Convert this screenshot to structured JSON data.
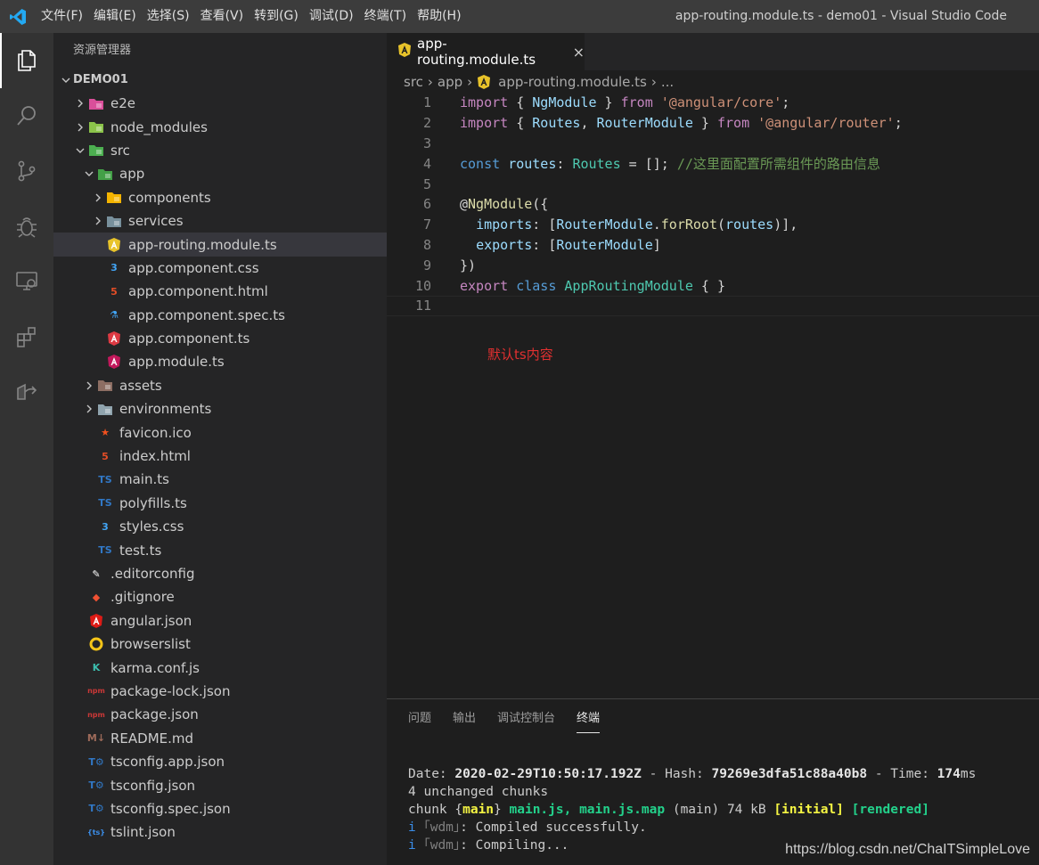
{
  "titlebar": {
    "menu": [
      "文件(F)",
      "编辑(E)",
      "选择(S)",
      "查看(V)",
      "转到(G)",
      "调试(D)",
      "终端(T)",
      "帮助(H)"
    ],
    "window_title": "app-routing.module.ts - demo01 - Visual Studio Code"
  },
  "activitybar": {
    "icons": [
      "explorer-icon",
      "search-icon",
      "source-control-icon",
      "debug-icon",
      "remote-explorer-icon",
      "extensions-icon",
      "live-share-icon"
    ]
  },
  "sidebar": {
    "title": "资源管理器",
    "section": "DEMO01",
    "items": [
      {
        "label": "e2e",
        "depth": 1,
        "chevron": "right",
        "icon": "folder-e2e-icon"
      },
      {
        "label": "node_modules",
        "depth": 1,
        "chevron": "right",
        "icon": "folder-node-icon"
      },
      {
        "label": "src",
        "depth": 1,
        "chevron": "down",
        "icon": "folder-src-icon"
      },
      {
        "label": "app",
        "depth": 2,
        "chevron": "down",
        "icon": "folder-app-icon"
      },
      {
        "label": "components",
        "depth": 3,
        "chevron": "right",
        "icon": "folder-components-icon"
      },
      {
        "label": "services",
        "depth": 3,
        "chevron": "right",
        "icon": "folder-services-icon"
      },
      {
        "label": "app-routing.module.ts",
        "depth": 3,
        "chevron": "",
        "icon": "angular-routing-icon",
        "selected": true
      },
      {
        "label": "app.component.css",
        "depth": 3,
        "chevron": "",
        "icon": "css-icon"
      },
      {
        "label": "app.component.html",
        "depth": 3,
        "chevron": "",
        "icon": "html-icon"
      },
      {
        "label": "app.component.spec.ts",
        "depth": 3,
        "chevron": "",
        "icon": "test-icon"
      },
      {
        "label": "app.component.ts",
        "depth": 3,
        "chevron": "",
        "icon": "angular-component-icon"
      },
      {
        "label": "app.module.ts",
        "depth": 3,
        "chevron": "",
        "icon": "angular-module-icon"
      },
      {
        "label": "assets",
        "depth": 2,
        "chevron": "right",
        "icon": "folder-assets-icon"
      },
      {
        "label": "environments",
        "depth": 2,
        "chevron": "right",
        "icon": "folder-icon"
      },
      {
        "label": "favicon.ico",
        "depth": 2,
        "chevron": "",
        "icon": "favicon-icon"
      },
      {
        "label": "index.html",
        "depth": 2,
        "chevron": "",
        "icon": "html-icon"
      },
      {
        "label": "main.ts",
        "depth": 2,
        "chevron": "",
        "icon": "typescript-icon"
      },
      {
        "label": "polyfills.ts",
        "depth": 2,
        "chevron": "",
        "icon": "typescript-icon"
      },
      {
        "label": "styles.css",
        "depth": 2,
        "chevron": "",
        "icon": "css-icon"
      },
      {
        "label": "test.ts",
        "depth": 2,
        "chevron": "",
        "icon": "typescript-icon"
      },
      {
        "label": ".editorconfig",
        "depth": 1,
        "chevron": "",
        "icon": "editorconfig-icon"
      },
      {
        "label": ".gitignore",
        "depth": 1,
        "chevron": "",
        "icon": "git-icon"
      },
      {
        "label": "angular.json",
        "depth": 1,
        "chevron": "",
        "icon": "angular-icon"
      },
      {
        "label": "browserslist",
        "depth": 1,
        "chevron": "",
        "icon": "browserslist-icon"
      },
      {
        "label": "karma.conf.js",
        "depth": 1,
        "chevron": "",
        "icon": "karma-icon"
      },
      {
        "label": "package-lock.json",
        "depth": 1,
        "chevron": "",
        "icon": "npm-icon"
      },
      {
        "label": "package.json",
        "depth": 1,
        "chevron": "",
        "icon": "npm-icon"
      },
      {
        "label": "README.md",
        "depth": 1,
        "chevron": "",
        "icon": "markdown-icon"
      },
      {
        "label": "tsconfig.app.json",
        "depth": 1,
        "chevron": "",
        "icon": "tsconfig-icon"
      },
      {
        "label": "tsconfig.json",
        "depth": 1,
        "chevron": "",
        "icon": "tsconfig-icon"
      },
      {
        "label": "tsconfig.spec.json",
        "depth": 1,
        "chevron": "",
        "icon": "tsconfig-icon"
      },
      {
        "label": "tslint.json",
        "depth": 1,
        "chevron": "",
        "icon": "tslint-icon"
      }
    ]
  },
  "editor": {
    "tab": {
      "label": "app-routing.module.ts",
      "close": "×"
    },
    "breadcrumb": [
      "src",
      "app",
      "app-routing.module.ts",
      "..."
    ],
    "lines": [
      [
        [
          "kw2",
          "import"
        ],
        [
          "pl",
          " { "
        ],
        [
          "var",
          "NgModule"
        ],
        [
          "pl",
          " } "
        ],
        [
          "kw2",
          "from"
        ],
        [
          "pl",
          " "
        ],
        [
          "str",
          "'@angular/core'"
        ],
        [
          "pl",
          ";"
        ]
      ],
      [
        [
          "kw2",
          "import"
        ],
        [
          "pl",
          " { "
        ],
        [
          "var",
          "Routes"
        ],
        [
          "pl",
          ", "
        ],
        [
          "var",
          "RouterModule"
        ],
        [
          "pl",
          " } "
        ],
        [
          "kw2",
          "from"
        ],
        [
          "pl",
          " "
        ],
        [
          "str",
          "'@angular/router'"
        ],
        [
          "pl",
          ";"
        ]
      ],
      [],
      [
        [
          "kw",
          "const"
        ],
        [
          "pl",
          " "
        ],
        [
          "var",
          "routes"
        ],
        [
          "pl",
          ": "
        ],
        [
          "cls",
          "Routes"
        ],
        [
          "pl",
          " = []; "
        ],
        [
          "cmt",
          "//这里面配置所需组件的路由信息"
        ]
      ],
      [],
      [
        [
          "pl",
          "@"
        ],
        [
          "fn",
          "NgModule"
        ],
        [
          "pl",
          "({"
        ]
      ],
      [
        [
          "pl",
          "  "
        ],
        [
          "var",
          "imports"
        ],
        [
          "pl",
          ": ["
        ],
        [
          "var",
          "RouterModule"
        ],
        [
          "pl",
          "."
        ],
        [
          "fn",
          "forRoot"
        ],
        [
          "pl",
          "("
        ],
        [
          "var",
          "routes"
        ],
        [
          "pl",
          ")],"
        ]
      ],
      [
        [
          "pl",
          "  "
        ],
        [
          "var",
          "exports"
        ],
        [
          "pl",
          ": ["
        ],
        [
          "var",
          "RouterModule"
        ],
        [
          "pl",
          "]"
        ]
      ],
      [
        [
          "pl",
          "})"
        ]
      ],
      [
        [
          "kw2",
          "export"
        ],
        [
          "pl",
          " "
        ],
        [
          "kw",
          "class"
        ],
        [
          "pl",
          " "
        ],
        [
          "cls",
          "AppRoutingModule"
        ],
        [
          "pl",
          " { }"
        ]
      ],
      []
    ],
    "line_numbers": [
      "1",
      "2",
      "3",
      "4",
      "5",
      "6",
      "7",
      "8",
      "9",
      "10",
      "11"
    ],
    "annotation": "默认ts内容"
  },
  "panel": {
    "tabs": [
      "问题",
      "输出",
      "调试控制台",
      "终端"
    ],
    "active_tab": "终端",
    "terminal": {
      "line1": {
        "a": "Date: ",
        "date": "2020-02-29T10:50:17.192Z",
        "b": " - Hash: ",
        "hash": "79269e3dfa51c88a40b8",
        "c": " - Time: ",
        "time": "174",
        "d": "ms"
      },
      "line2": "4 unchanged chunks",
      "line3": {
        "a": "chunk {",
        "main": "main",
        "b": "} ",
        "files": "main.js, main.js.map",
        "c": " (main) 74 kB ",
        "initial": "[initial]",
        "d": " ",
        "rendered": "[rendered]"
      },
      "line4": {
        "i": "i",
        "wdm": "｢wdm｣",
        "text": ": Compiled successfully."
      },
      "line5": {
        "i": "i",
        "wdm": "｢wdm｣",
        "text": ": Compiling..."
      }
    }
  },
  "watermark": "https://blog.csdn.net/ChaITSimpleLove"
}
